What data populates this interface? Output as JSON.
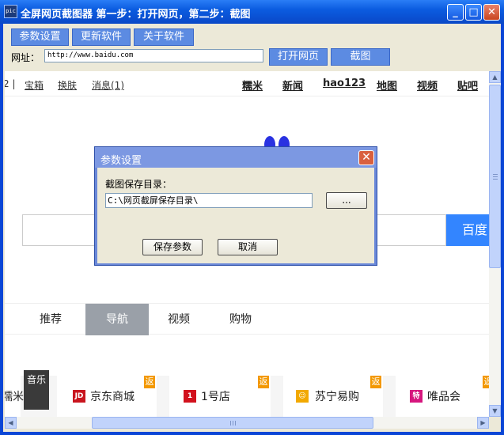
{
  "window": {
    "title": "全屏网页截图器  第一步：打开网页，第二步：截图",
    "icon_text": "pic",
    "min_glyph": "_",
    "max_glyph": "□",
    "close_glyph": "✕"
  },
  "toolbar": {
    "settings_label": "参数设置",
    "update_label": "更新软件",
    "about_label": "关于软件",
    "url_label": "网址：",
    "url_value": "http://www.baidu.com",
    "open_label": "打开网页",
    "capture_label": "截图"
  },
  "browser": {
    "nav_left": [
      "2 |",
      "宝箱",
      "换肤",
      "消息(1)"
    ],
    "nav_right": [
      "糯米",
      "新闻",
      "hao123",
      "地图",
      "视频",
      "贴吧"
    ],
    "search_button": "百度",
    "tabs": [
      "推荐",
      "导航",
      "视频",
      "购物"
    ],
    "active_tab": "导航",
    "music_tab": "音乐",
    "cards": [
      {
        "label": "糯米",
        "icon": "",
        "icon_color": ""
      },
      {
        "label": "京东商城",
        "icon": "JD",
        "icon_color": "#c9151e"
      },
      {
        "label": "1号店",
        "icon": "1",
        "icon_color": "#d2111d"
      },
      {
        "label": "苏宁易购",
        "icon": "☺",
        "icon_color": "#f2a900"
      },
      {
        "label": "唯品会",
        "icon": "特",
        "icon_color": "#d6167e"
      }
    ],
    "fan_label": "返"
  },
  "dialog": {
    "title": "参数设置",
    "close_glyph": "✕",
    "dir_label": "截图保存目录：",
    "dir_value": "C:\\网页截屏保存目录\\",
    "browse_label": "...",
    "save_label": "保存参数",
    "cancel_label": "取消"
  },
  "scrollbars": {
    "up": "▲",
    "down": "▼",
    "left": "◀",
    "right": "▶"
  }
}
